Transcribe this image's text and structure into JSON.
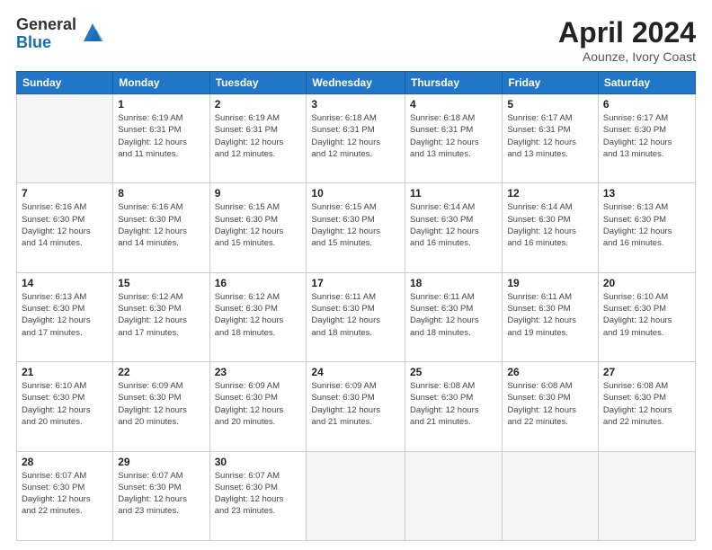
{
  "logo": {
    "general": "General",
    "blue": "Blue"
  },
  "header": {
    "title": "April 2024",
    "subtitle": "Aounze, Ivory Coast"
  },
  "days_of_week": [
    "Sunday",
    "Monday",
    "Tuesday",
    "Wednesday",
    "Thursday",
    "Friday",
    "Saturday"
  ],
  "weeks": [
    [
      {
        "num": "",
        "info": ""
      },
      {
        "num": "1",
        "info": "Sunrise: 6:19 AM\nSunset: 6:31 PM\nDaylight: 12 hours\nand 11 minutes."
      },
      {
        "num": "2",
        "info": "Sunrise: 6:19 AM\nSunset: 6:31 PM\nDaylight: 12 hours\nand 12 minutes."
      },
      {
        "num": "3",
        "info": "Sunrise: 6:18 AM\nSunset: 6:31 PM\nDaylight: 12 hours\nand 12 minutes."
      },
      {
        "num": "4",
        "info": "Sunrise: 6:18 AM\nSunset: 6:31 PM\nDaylight: 12 hours\nand 13 minutes."
      },
      {
        "num": "5",
        "info": "Sunrise: 6:17 AM\nSunset: 6:31 PM\nDaylight: 12 hours\nand 13 minutes."
      },
      {
        "num": "6",
        "info": "Sunrise: 6:17 AM\nSunset: 6:30 PM\nDaylight: 12 hours\nand 13 minutes."
      }
    ],
    [
      {
        "num": "7",
        "info": "Sunrise: 6:16 AM\nSunset: 6:30 PM\nDaylight: 12 hours\nand 14 minutes."
      },
      {
        "num": "8",
        "info": "Sunrise: 6:16 AM\nSunset: 6:30 PM\nDaylight: 12 hours\nand 14 minutes."
      },
      {
        "num": "9",
        "info": "Sunrise: 6:15 AM\nSunset: 6:30 PM\nDaylight: 12 hours\nand 15 minutes."
      },
      {
        "num": "10",
        "info": "Sunrise: 6:15 AM\nSunset: 6:30 PM\nDaylight: 12 hours\nand 15 minutes."
      },
      {
        "num": "11",
        "info": "Sunrise: 6:14 AM\nSunset: 6:30 PM\nDaylight: 12 hours\nand 16 minutes."
      },
      {
        "num": "12",
        "info": "Sunrise: 6:14 AM\nSunset: 6:30 PM\nDaylight: 12 hours\nand 16 minutes."
      },
      {
        "num": "13",
        "info": "Sunrise: 6:13 AM\nSunset: 6:30 PM\nDaylight: 12 hours\nand 16 minutes."
      }
    ],
    [
      {
        "num": "14",
        "info": "Sunrise: 6:13 AM\nSunset: 6:30 PM\nDaylight: 12 hours\nand 17 minutes."
      },
      {
        "num": "15",
        "info": "Sunrise: 6:12 AM\nSunset: 6:30 PM\nDaylight: 12 hours\nand 17 minutes."
      },
      {
        "num": "16",
        "info": "Sunrise: 6:12 AM\nSunset: 6:30 PM\nDaylight: 12 hours\nand 18 minutes."
      },
      {
        "num": "17",
        "info": "Sunrise: 6:11 AM\nSunset: 6:30 PM\nDaylight: 12 hours\nand 18 minutes."
      },
      {
        "num": "18",
        "info": "Sunrise: 6:11 AM\nSunset: 6:30 PM\nDaylight: 12 hours\nand 18 minutes."
      },
      {
        "num": "19",
        "info": "Sunrise: 6:11 AM\nSunset: 6:30 PM\nDaylight: 12 hours\nand 19 minutes."
      },
      {
        "num": "20",
        "info": "Sunrise: 6:10 AM\nSunset: 6:30 PM\nDaylight: 12 hours\nand 19 minutes."
      }
    ],
    [
      {
        "num": "21",
        "info": "Sunrise: 6:10 AM\nSunset: 6:30 PM\nDaylight: 12 hours\nand 20 minutes."
      },
      {
        "num": "22",
        "info": "Sunrise: 6:09 AM\nSunset: 6:30 PM\nDaylight: 12 hours\nand 20 minutes."
      },
      {
        "num": "23",
        "info": "Sunrise: 6:09 AM\nSunset: 6:30 PM\nDaylight: 12 hours\nand 20 minutes."
      },
      {
        "num": "24",
        "info": "Sunrise: 6:09 AM\nSunset: 6:30 PM\nDaylight: 12 hours\nand 21 minutes."
      },
      {
        "num": "25",
        "info": "Sunrise: 6:08 AM\nSunset: 6:30 PM\nDaylight: 12 hours\nand 21 minutes."
      },
      {
        "num": "26",
        "info": "Sunrise: 6:08 AM\nSunset: 6:30 PM\nDaylight: 12 hours\nand 22 minutes."
      },
      {
        "num": "27",
        "info": "Sunrise: 6:08 AM\nSunset: 6:30 PM\nDaylight: 12 hours\nand 22 minutes."
      }
    ],
    [
      {
        "num": "28",
        "info": "Sunrise: 6:07 AM\nSunset: 6:30 PM\nDaylight: 12 hours\nand 22 minutes."
      },
      {
        "num": "29",
        "info": "Sunrise: 6:07 AM\nSunset: 6:30 PM\nDaylight: 12 hours\nand 23 minutes."
      },
      {
        "num": "30",
        "info": "Sunrise: 6:07 AM\nSunset: 6:30 PM\nDaylight: 12 hours\nand 23 minutes."
      },
      {
        "num": "",
        "info": ""
      },
      {
        "num": "",
        "info": ""
      },
      {
        "num": "",
        "info": ""
      },
      {
        "num": "",
        "info": ""
      }
    ]
  ]
}
